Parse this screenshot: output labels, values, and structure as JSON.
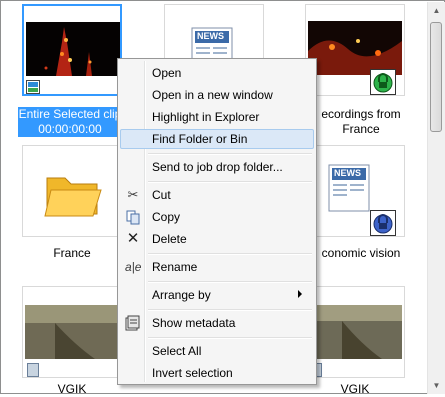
{
  "tiles": [
    {
      "caption": "Entire Selected clip",
      "timecode": "00:00:00:00",
      "selected": true
    },
    {
      "caption": "",
      "timecode": ""
    },
    {
      "caption_line1": "ecordings from",
      "caption_line2": "France"
    },
    {
      "caption": "France"
    },
    {
      "caption": ""
    },
    {
      "caption": "conomic vision"
    },
    {
      "caption": "VGIK"
    },
    {
      "caption": ""
    },
    {
      "caption": "VGIK"
    }
  ],
  "news_label": "NEWS",
  "menu": {
    "items": [
      {
        "label": "Open",
        "icon": ""
      },
      {
        "label": "Open in a new window",
        "icon": ""
      },
      {
        "label": "Highlight in Explorer",
        "icon": ""
      },
      {
        "label": "Find Folder or Bin",
        "icon": "",
        "highlighted": true
      },
      {
        "label": "Send to job drop folder...",
        "icon": ""
      },
      {
        "label": "Cut",
        "icon": "scissors-icon"
      },
      {
        "label": "Copy",
        "icon": "copy-icon"
      },
      {
        "label": "Delete",
        "icon": "delete-x-icon"
      },
      {
        "label": "Rename",
        "icon": "rename-icon"
      },
      {
        "label": "Arrange by",
        "icon": "",
        "submenu": true
      },
      {
        "label": "Show metadata",
        "icon": "metadata-icon"
      },
      {
        "label": "Select All",
        "icon": ""
      },
      {
        "label": "Invert selection",
        "icon": ""
      }
    ]
  },
  "colors": {
    "selection": "#3399ff",
    "menu_highlight": "#dbe8f7",
    "lock_green": "#2db34a"
  }
}
